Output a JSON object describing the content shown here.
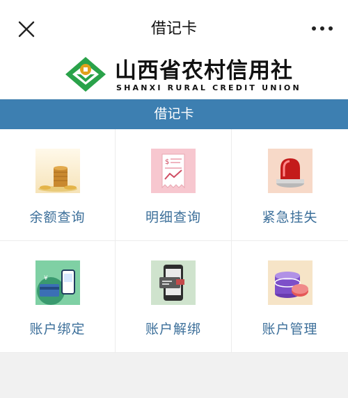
{
  "navbar": {
    "title": "借记卡",
    "close_icon": "close-icon",
    "more_icon": "more-icon"
  },
  "brand": {
    "name_cn": "山西省农村信用社",
    "name_en": "SHANXI RURAL CREDIT UNION",
    "logo_icon": "shanxi-rcu-logo",
    "logo_color": "#2aa24a",
    "logo_coin_color": "#e1a11b"
  },
  "section": {
    "title": "借记卡",
    "color": "#3d7fb1"
  },
  "tiles": [
    {
      "label": "余额查询",
      "icon": "coins-icon"
    },
    {
      "label": "明细查询",
      "icon": "receipt-icon"
    },
    {
      "label": "紧急挂失",
      "icon": "alarm-light-icon"
    },
    {
      "label": "账户绑定",
      "icon": "card-phone-bind-icon"
    },
    {
      "label": "账户解绑",
      "icon": "phone-card-unbind-icon"
    },
    {
      "label": "账户管理",
      "icon": "database-manage-icon"
    }
  ],
  "colors": {
    "tile_label": "#3c6f9a",
    "background": "#f1f1f1"
  }
}
